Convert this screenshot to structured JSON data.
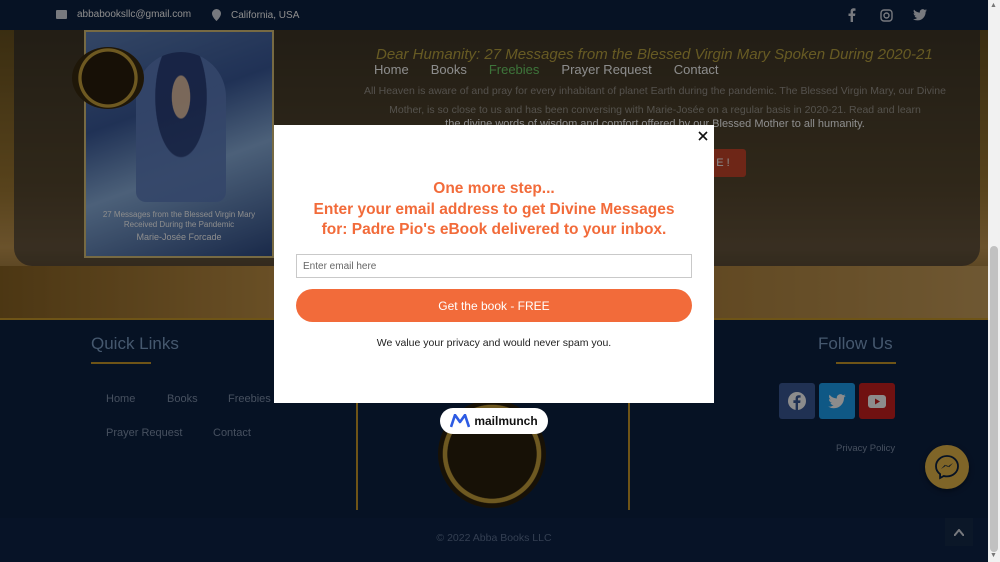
{
  "topbar": {
    "email": "abbabooksllc@gmail.com",
    "location": "California, USA",
    "social_icons": [
      "facebook-icon",
      "instagram-icon",
      "twitter-icon"
    ]
  },
  "nav": {
    "items": [
      "Home",
      "Books",
      "Freebies",
      "Prayer Request",
      "Contact"
    ],
    "active": "Freebies"
  },
  "hero": {
    "title": "Dear Humanity: 27 Messages from the Blessed Virgin Mary Spoken During 2020-21",
    "body": "All Heaven is aware of and pray for every inhabitant of planet Earth during the pandemic. The Blessed Virgin Mary, our Divine Mother, is so close to us and has been conversing with Marie-Josée on a regular basis in 2020-21. Read and learn",
    "body_highlight": "the divine words of wisdom and comfort offered by our Blessed Mother to all humanity.",
    "button_label": "E !",
    "book_caption": "27 Messages from the Blessed Virgin Mary Received During the Pandemic",
    "book_author": "Marie-Josée Forcade"
  },
  "footer": {
    "quick_links_title": "Quick Links",
    "quick_links": [
      "Home",
      "Books",
      "Freebies",
      "Prayer Request",
      "Contact"
    ],
    "follow_title": "Follow Us",
    "privacy": "Privacy Policy",
    "copyright": "© 2022 Abba Books LLC"
  },
  "modal": {
    "title_lines": [
      "One more step...",
      "Enter your email address to get Divine Messages",
      "for: Padre Pio's eBook delivered to your inbox."
    ],
    "email_placeholder": "Enter email here",
    "button_label": "Get the book - FREE",
    "privacy_note": "We value your privacy and would never spam you.",
    "badge": "mailmunch"
  },
  "colors": {
    "accent": "#f26b3a",
    "navy": "#0c2142",
    "gold": "#c99a2a",
    "facebook": "#3b5998",
    "twitter": "#1da1f2",
    "youtube": "#cd201f"
  }
}
